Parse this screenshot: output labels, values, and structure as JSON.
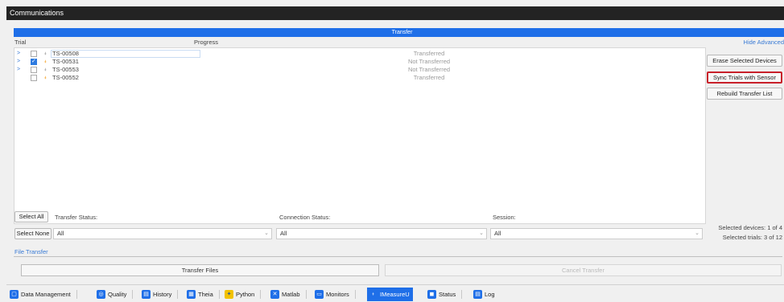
{
  "window": {
    "title": "Communications"
  },
  "transfer": {
    "header": "Transfer",
    "col_trial": "Trial",
    "col_progress": "Progress",
    "hide_advanced": "Hide Advanced",
    "rows": [
      {
        "expander": ">",
        "checked": false,
        "sensor_color": "gray",
        "name": "TS-00508",
        "status": "Transferred"
      },
      {
        "expander": ">",
        "checked": true,
        "sensor_color": "orange",
        "name": "TS-00531",
        "status": "Not Transferred"
      },
      {
        "expander": ">",
        "checked": false,
        "sensor_color": "gray",
        "name": "TS-00553",
        "status": "Not Transferred"
      },
      {
        "expander": "",
        "checked": false,
        "sensor_color": "orange",
        "name": "TS-00552",
        "status": "Transferred"
      }
    ]
  },
  "side_buttons": {
    "erase": "Erase Selected Devices",
    "sync": "Sync Trials with Sensor",
    "rebuild": "Rebuild Transfer List"
  },
  "filters": {
    "select_all": "Select All",
    "select_none": "Select None",
    "transfer_status_label": "Transfer Status:",
    "transfer_status_value": "All",
    "connection_status_label": "Connection Status:",
    "connection_status_value": "All",
    "session_label": "Session:",
    "session_value": "All",
    "selected_devices": "Selected devices:  1 of 4",
    "selected_trials": "Selected trials:  3 of 12"
  },
  "file_transfer": {
    "label": "File Transfer",
    "transfer_files": "Transfer Files",
    "cancel_transfer": "Cancel Transfer"
  },
  "tabs": [
    {
      "label": "Data Management",
      "icon": "data-management-icon",
      "color": "#1f6fe8",
      "active": false
    },
    {
      "label": "Quality",
      "icon": "quality-icon",
      "color": "#1f6fe8",
      "active": false
    },
    {
      "label": "History",
      "icon": "history-icon",
      "color": "#1f6fe8",
      "active": false
    },
    {
      "label": "Theia",
      "icon": "theia-icon",
      "color": "#1f6fe8",
      "active": false
    },
    {
      "label": "Python",
      "icon": "python-icon",
      "color": "#f2c200",
      "active": false
    },
    {
      "label": "Matlab",
      "icon": "matlab-icon",
      "color": "#1f6fe8",
      "active": false
    },
    {
      "label": "Monitors",
      "icon": "monitors-icon",
      "color": "#1f6fe8",
      "active": false
    },
    {
      "label": "IMeasureU",
      "icon": "imeasureu-icon",
      "color": "#ffffff",
      "active": true
    },
    {
      "label": "Status",
      "icon": "status-icon",
      "color": "#1f6fe8",
      "active": false
    },
    {
      "label": "Log",
      "icon": "log-icon",
      "color": "#1f6fe8",
      "active": false
    }
  ]
}
